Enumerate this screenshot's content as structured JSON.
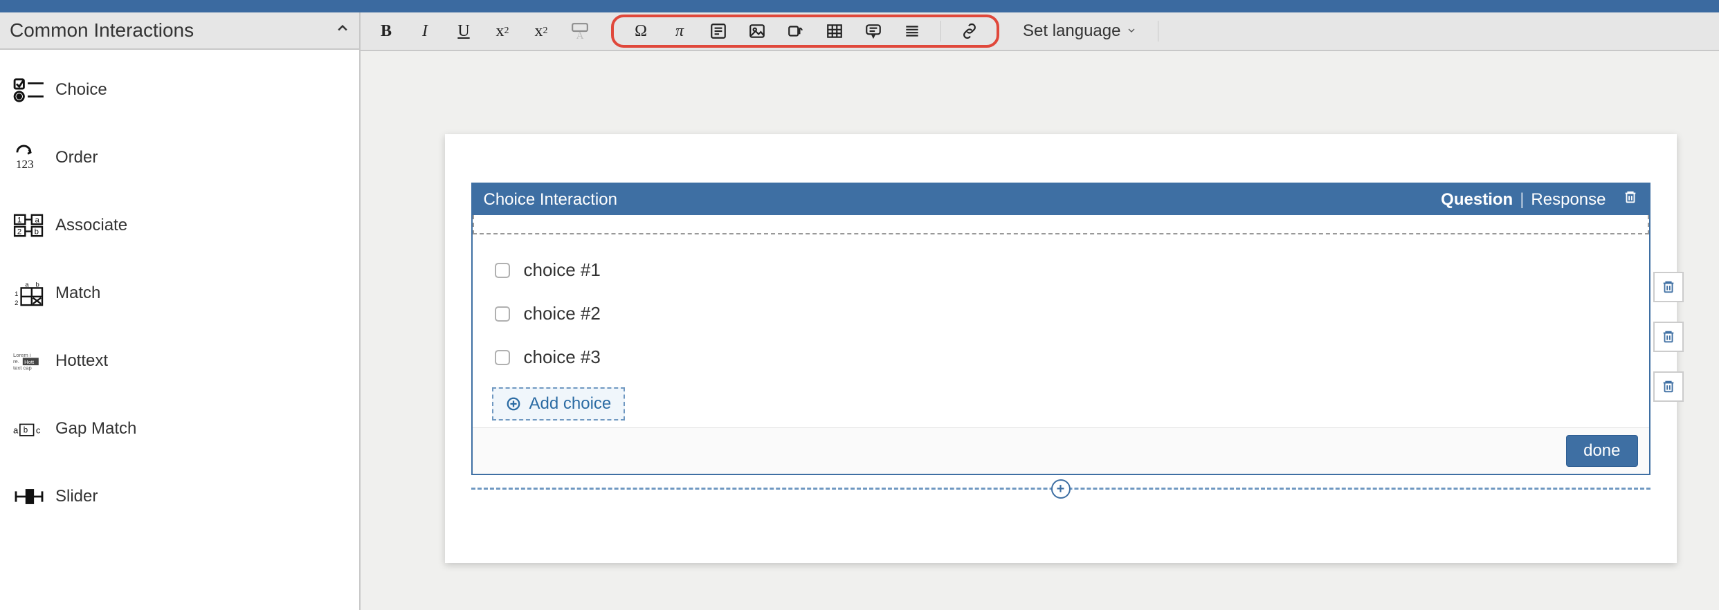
{
  "sidebar": {
    "title": "Common Interactions",
    "items": [
      {
        "label": "Choice"
      },
      {
        "label": "Order"
      },
      {
        "label": "Associate"
      },
      {
        "label": "Match"
      },
      {
        "label": "Hottext"
      },
      {
        "label": "Gap Match"
      },
      {
        "label": "Slider"
      }
    ]
  },
  "toolbar": {
    "lang_label": "Set language"
  },
  "block": {
    "title": "Choice Interaction",
    "tab_question": "Question",
    "tab_response": "Response",
    "choices": [
      {
        "label": "choice #1"
      },
      {
        "label": "choice #2"
      },
      {
        "label": "choice #3"
      }
    ],
    "add_label": "Add choice",
    "done_label": "done"
  }
}
